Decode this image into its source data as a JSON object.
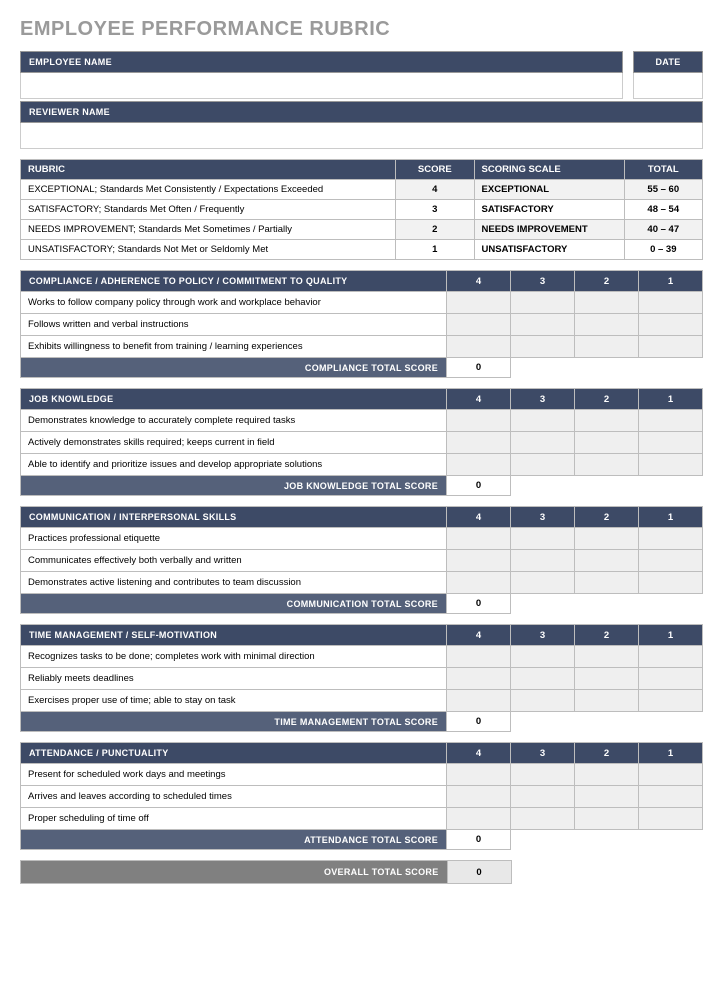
{
  "title": "EMPLOYEE PERFORMANCE RUBRIC",
  "labels": {
    "employee_name": "EMPLOYEE NAME",
    "reviewer_name": "REVIEWER NAME",
    "date": "DATE",
    "rubric": "RUBRIC",
    "score": "SCORE",
    "scoring_scale": "SCORING SCALE",
    "total": "TOTAL",
    "overall_total": "OVERALL TOTAL SCORE"
  },
  "rubric_rows": [
    {
      "desc": "EXCEPTIONAL; Standards Met Consistently / Expectations Exceeded",
      "score": "4",
      "scale": "EXCEPTIONAL",
      "range": "55 – 60"
    },
    {
      "desc": "SATISFACTORY; Standards Met Often / Frequently",
      "score": "3",
      "scale": "SATISFACTORY",
      "range": "48 – 54"
    },
    {
      "desc": "NEEDS IMPROVEMENT; Standards Met Sometimes / Partially",
      "score": "2",
      "scale": "NEEDS IMPROVEMENT",
      "range": "40 – 47"
    },
    {
      "desc": "UNSATISFACTORY; Standards Not Met or Seldomly Met",
      "score": "1",
      "scale": "UNSATISFACTORY",
      "range": "0 – 39"
    }
  ],
  "score_headers": [
    "4",
    "3",
    "2",
    "1"
  ],
  "sections": [
    {
      "title": "COMPLIANCE / ADHERENCE TO POLICY / COMMITMENT TO QUALITY",
      "criteria": [
        "Works to follow company policy through work and workplace behavior",
        "Follows written and verbal instructions",
        "Exhibits willingness to benefit from training / learning experiences"
      ],
      "total_label": "COMPLIANCE TOTAL SCORE",
      "total_value": "0"
    },
    {
      "title": "JOB KNOWLEDGE",
      "criteria": [
        "Demonstrates knowledge to accurately complete required tasks",
        "Actively demonstrates skills required; keeps current in field",
        "Able to identify and prioritize issues and develop appropriate solutions"
      ],
      "total_label": "JOB KNOWLEDGE TOTAL SCORE",
      "total_value": "0"
    },
    {
      "title": "COMMUNICATION / INTERPERSONAL SKILLS",
      "criteria": [
        "Practices professional etiquette",
        "Communicates effectively both verbally and written",
        "Demonstrates active listening and contributes to team discussion"
      ],
      "total_label": "COMMUNICATION TOTAL SCORE",
      "total_value": "0"
    },
    {
      "title": "TIME MANAGEMENT / SELF-MOTIVATION",
      "criteria": [
        "Recognizes tasks to be done; completes work with minimal direction",
        "Reliably meets deadlines",
        "Exercises proper use of time; able to stay on task"
      ],
      "total_label": "TIME MANAGEMENT TOTAL SCORE",
      "total_value": "0"
    },
    {
      "title": "ATTENDANCE / PUNCTUALITY",
      "criteria": [
        "Present for scheduled work days and meetings",
        "Arrives and leaves according to scheduled times",
        "Proper scheduling of time off"
      ],
      "total_label": "ATTENDANCE TOTAL SCORE",
      "total_value": "0"
    }
  ],
  "overall_value": "0"
}
